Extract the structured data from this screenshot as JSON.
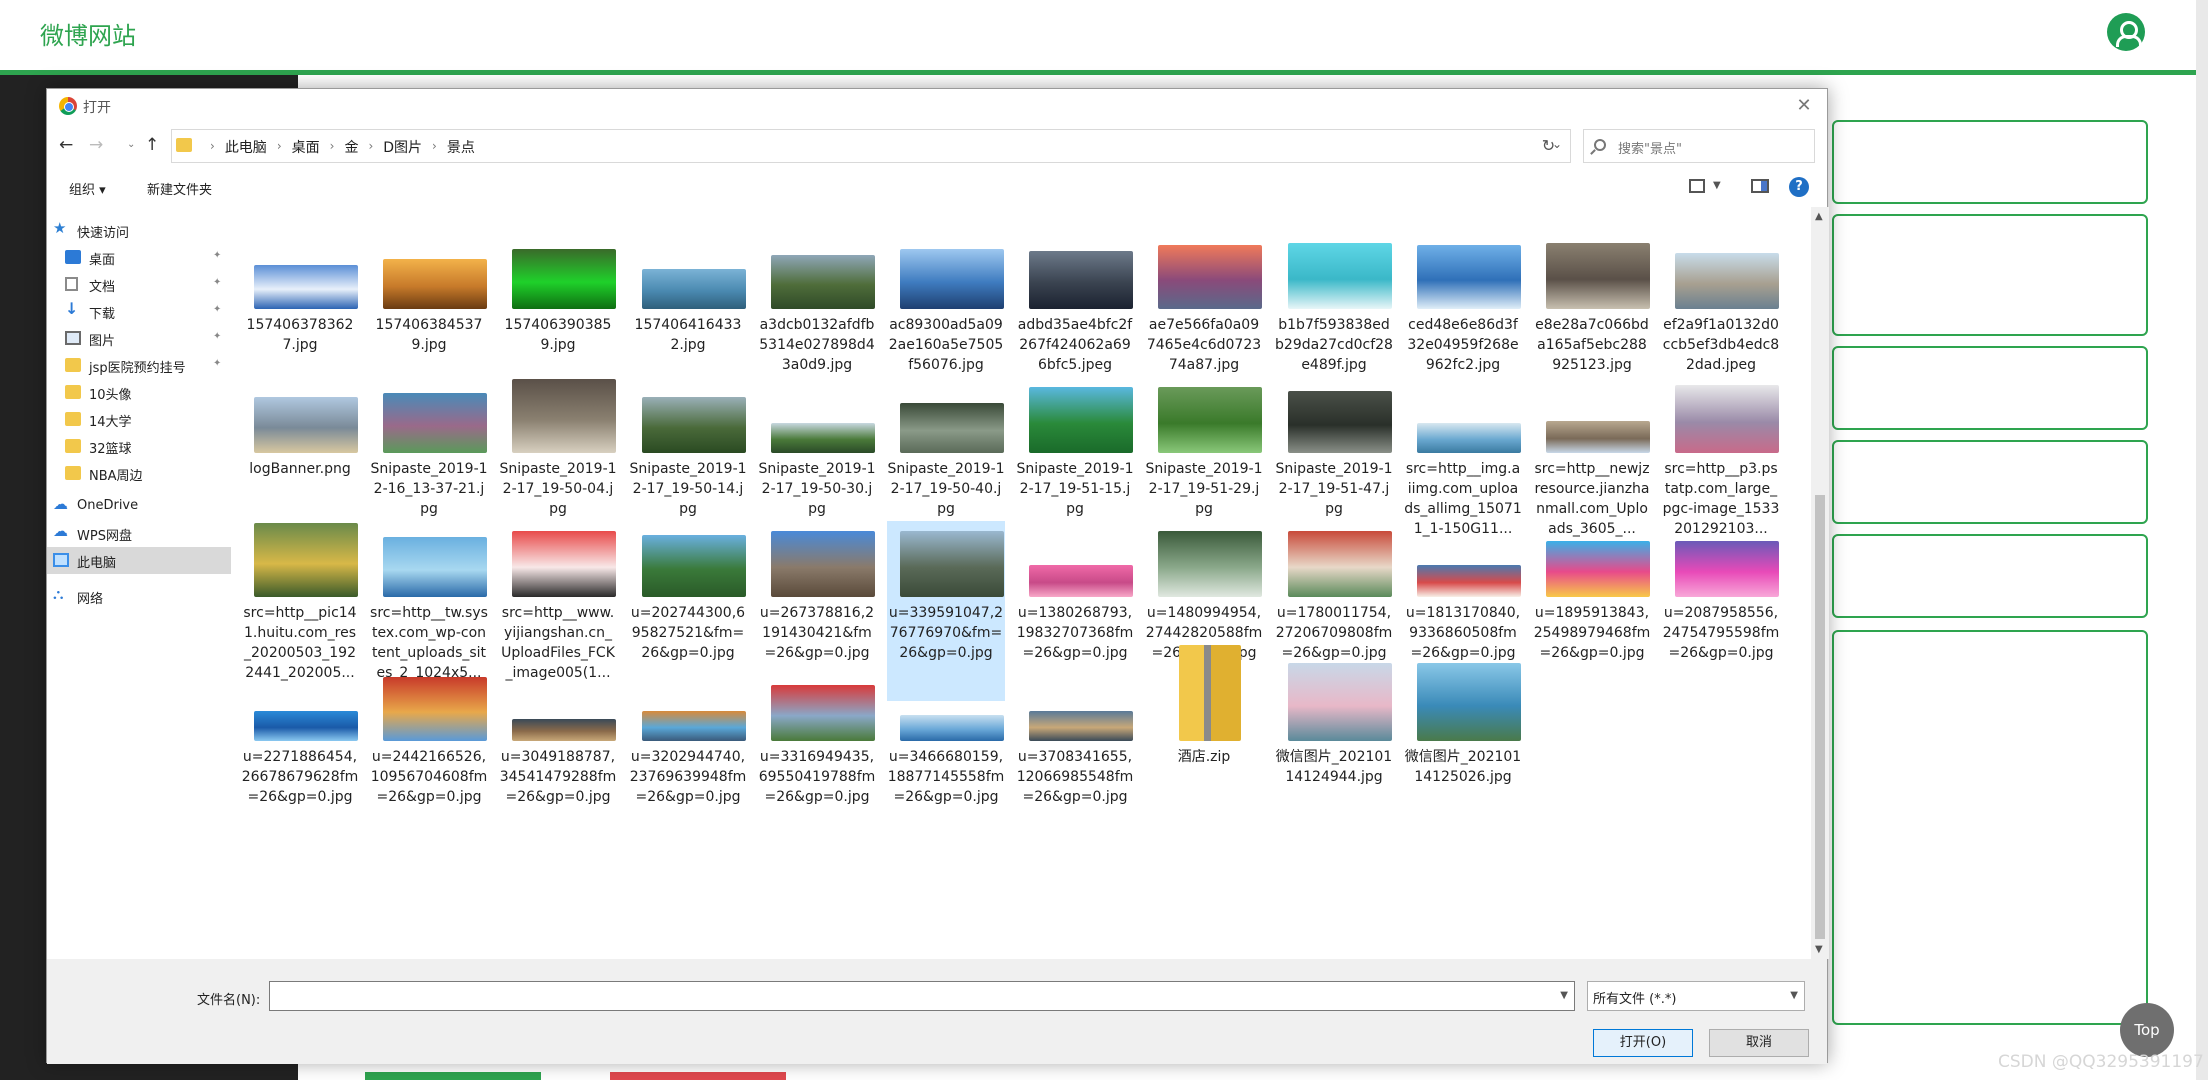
{
  "site": {
    "logo": "微博网站",
    "top_label": "Top",
    "watermark": "CSDN @QQ3295391197"
  },
  "dialog": {
    "title": "打开",
    "breadcrumbs": [
      "此电脑",
      "桌面",
      "金",
      "D图片",
      "景点"
    ],
    "search_placeholder": "搜索\"景点\"",
    "toolbar": {
      "organize": "组织 ▾",
      "new_folder": "新建文件夹"
    },
    "nav": [
      {
        "label": "快速访问",
        "icon": "star-icon",
        "pinned": false,
        "indent": 0
      },
      {
        "label": "桌面",
        "icon": "desktop-icon",
        "pinned": true,
        "indent": 1
      },
      {
        "label": "文档",
        "icon": "document-icon",
        "pinned": true,
        "indent": 1
      },
      {
        "label": "下载",
        "icon": "download-icon",
        "pinned": true,
        "indent": 1
      },
      {
        "label": "图片",
        "icon": "pictures-icon",
        "pinned": true,
        "indent": 1
      },
      {
        "label": "jsp医院预约挂号",
        "icon": "folder-icon",
        "pinned": true,
        "indent": 1
      },
      {
        "label": "10头像",
        "icon": "folder-icon",
        "pinned": false,
        "indent": 1
      },
      {
        "label": "14大学",
        "icon": "folder-icon",
        "pinned": false,
        "indent": 1
      },
      {
        "label": "32篮球",
        "icon": "folder-icon",
        "pinned": false,
        "indent": 1
      },
      {
        "label": "NBA周边",
        "icon": "folder-icon",
        "pinned": false,
        "indent": 1
      },
      {
        "label": "OneDrive",
        "icon": "onedrive-icon",
        "pinned": false,
        "indent": 0
      },
      {
        "label": "WPS网盘",
        "icon": "wps-cloud-icon",
        "pinned": false,
        "indent": 0
      },
      {
        "label": "此电脑",
        "icon": "this-pc-icon",
        "pinned": false,
        "indent": 0,
        "selected": true
      },
      {
        "label": "网络",
        "icon": "network-icon",
        "pinned": false,
        "indent": 0
      }
    ],
    "files": [
      {
        "name": "1574063783627.jpg",
        "colors": [
          "#5b8fd6",
          "#e8f0fa",
          "#2c63b3"
        ]
      },
      {
        "name": "1574063845379.jpg",
        "colors": [
          "#f3b24a",
          "#c77a2a",
          "#6a3b12"
        ]
      },
      {
        "name": "1574063903859.jpg",
        "colors": [
          "#3a6a2a",
          "#1fd12a",
          "#0f6e12"
        ]
      },
      {
        "name": "1574064164332.jpg",
        "colors": [
          "#7bb3d6",
          "#4a89b0",
          "#2f5f7a"
        ]
      },
      {
        "name": "a3dcb0132afdfb5314e027898d43a0d9.jpg",
        "colors": [
          "#8fa7b8",
          "#4f6d3a",
          "#2f4a28"
        ]
      },
      {
        "name": "ac89300ad5a092ae160a5e7505f56076.jpg",
        "colors": [
          "#9ec8f0",
          "#3f7cc0",
          "#1e3f70"
        ]
      },
      {
        "name": "adbd35ae4bfc2f267f424062a696bfc5.jpeg",
        "colors": [
          "#6d7a8a",
          "#3a4350",
          "#1b2230"
        ]
      },
      {
        "name": "ae7e566fa0a097465e4c6d072374a87.jpg",
        "colors": [
          "#f07a5a",
          "#8a4a7a",
          "#5a6a8a"
        ]
      },
      {
        "name": "b1b7f593838edb29da27cd0cf28e489f.jpg",
        "colors": [
          "#5fd6e6",
          "#3ab8c8",
          "#e8f6f8"
        ]
      },
      {
        "name": "ced48e6e86d3f32e04959f268e962fc2.jpg",
        "colors": [
          "#6fb0e8",
          "#2f70b8",
          "#e0eef8"
        ]
      },
      {
        "name": "e8e28a7c066bda165af5ebc288925123.jpg",
        "colors": [
          "#8a8070",
          "#5a5048",
          "#c8c0b0"
        ]
      },
      {
        "name": "ef2a9f1a0132d0ccb5ef3db4edc82dad.jpeg",
        "colors": [
          "#c8dcea",
          "#a8a090",
          "#6a8090"
        ]
      },
      {
        "name": "logBanner.png",
        "colors": [
          "#b0c8e0",
          "#7a8a98",
          "#d8c8a0"
        ]
      },
      {
        "name": "Snipaste_2019-12-16_13-37-21.jpg",
        "colors": [
          "#4a8ab8",
          "#9a6a8a",
          "#5a9a5a"
        ]
      },
      {
        "name": "Snipaste_2019-12-17_19-50-04.jpg",
        "colors": [
          "#5a5048",
          "#8a8070",
          "#d8d0c0"
        ]
      },
      {
        "name": "Snipaste_2019-12-17_19-50-14.jpg",
        "colors": [
          "#9ab0b8",
          "#4a6a3a",
          "#2a4a22"
        ]
      },
      {
        "name": "Snipaste_2019-12-17_19-50-30.jpg",
        "colors": [
          "#c8d8e0",
          "#4a7a3a",
          "#2a4a28"
        ]
      },
      {
        "name": "Snipaste_2019-12-17_19-50-40.jpg",
        "colors": [
          "#3a4a38",
          "#8a9a88",
          "#5a6a58"
        ]
      },
      {
        "name": "Snipaste_2019-12-17_19-51-15.jpg",
        "colors": [
          "#5ab8e0",
          "#2a8a3a",
          "#1a6a2a"
        ]
      },
      {
        "name": "Snipaste_2019-12-17_19-51-29.jpg",
        "colors": [
          "#6a9a5a",
          "#3a7a2a",
          "#8ac87a"
        ]
      },
      {
        "name": "Snipaste_2019-12-17_19-51-47.jpg",
        "colors": [
          "#4a5048",
          "#2a302a",
          "#8a9088"
        ]
      },
      {
        "name": "src=http__img.aiimg.com_uploads_allimg_150711_1-150G11...",
        "colors": [
          "#d8e8f0",
          "#6aa8d0",
          "#3a7aa0"
        ]
      },
      {
        "name": "src=http__newjzresource.jianzhanmall.com_Uploads_3605_...",
        "colors": [
          "#b8a890",
          "#7a6a58",
          "#c8d8e8"
        ]
      },
      {
        "name": "src=http__p3.pstatp.com_large_pgc-image_1533201292103...",
        "colors": [
          "#e8e8ea",
          "#9a8aa8",
          "#c86a8a"
        ]
      },
      {
        "name": "src=http__pic141.huitu.com_res_20200503_1922441_202005...",
        "colors": [
          "#6a8a4a",
          "#d8b848",
          "#3a5a2a"
        ]
      },
      {
        "name": "src=http__tw.systex.com_wp-content_uploads_sites_2_1024x5...",
        "colors": [
          "#6ab0e0",
          "#a8d8f0",
          "#2a6aa8"
        ]
      },
      {
        "name": "src=http__www.yijiangshan.cn_UploadFiles_FCK_image005(1...",
        "colors": [
          "#e84a4a",
          "#f8e8e8",
          "#2a2a2a"
        ]
      },
      {
        "name": "u=202744300,695827521&fm=26&gp=0.jpg",
        "colors": [
          "#6ab0e0",
          "#3a7a3a",
          "#2a5a28"
        ]
      },
      {
        "name": "u=267378816,2191430421&fm=26&gp=0.jpg",
        "colors": [
          "#4a8ad8",
          "#8a7a6a",
          "#5a4a3a"
        ]
      },
      {
        "name": "u=339591047,276776970&fm=26&gp=0.jpg",
        "colors": [
          "#9ab8d0",
          "#5a6a58",
          "#3a4a38"
        ],
        "selected": true
      },
      {
        "name": "u=1380268793,19832707368fm=26&gp=0.jpg",
        "colors": [
          "#f06aa8",
          "#c84a88",
          "#f8a8c8"
        ]
      },
      {
        "name": "u=1480994954,27442820588fm=26&gp=0.jpg",
        "colors": [
          "#3a5a3a",
          "#8aa88a",
          "#e0e8e0"
        ]
      },
      {
        "name": "u=1780011754,27206709808fm=26&gp=0.jpg",
        "colors": [
          "#c84a3a",
          "#e8d8c8",
          "#5a8a5a"
        ]
      },
      {
        "name": "u=1813170840,9336860508fm=26&gp=0.jpg",
        "colors": [
          "#4a7ab0",
          "#d84a4a",
          "#f8f0e8"
        ]
      },
      {
        "name": "u=1895913843,25498979468fm=26&gp=0.jpg",
        "colors": [
          "#3ab0e8",
          "#e84a8a",
          "#f8c848"
        ]
      },
      {
        "name": "u=2087958556,24754795598fm=26&gp=0.jpg",
        "colors": [
          "#6a5ab8",
          "#e84ab8",
          "#f8a8d8"
        ]
      },
      {
        "name": "u=2271886454,26678679628fm=26&gp=0.jpg",
        "colors": [
          "#2a8ad8",
          "#1a5aa8",
          "#8ac8f0"
        ]
      },
      {
        "name": "u=2442166526,10956704608fm=26&gp=0.jpg",
        "colors": [
          "#c83a2a",
          "#e8a84a",
          "#5a9ad8"
        ]
      },
      {
        "name": "u=3049188787,34541479288fm=26&gp=0.jpg",
        "colors": [
          "#3a4a58",
          "#8a6a4a",
          "#c8a878"
        ]
      },
      {
        "name": "u=3202944740,23769639948fm=26&gp=0.jpg",
        "colors": [
          "#d88a3a",
          "#5aa8d8",
          "#3a5a7a"
        ]
      },
      {
        "name": "u=3316949435,69550419788fm=26&gp=0.jpg",
        "colors": [
          "#d83a3a",
          "#8aa8c8",
          "#4a7a3a"
        ]
      },
      {
        "name": "u=3466680159,18877145558fm=26&gp=0.jpg",
        "colors": [
          "#c8e0f0",
          "#6aa8d8",
          "#2a6aa8"
        ]
      },
      {
        "name": "u=3708341655,12066985548fm=26&gp=0.jpg",
        "colors": [
          "#5a7a98",
          "#c8a878",
          "#3a4a58"
        ]
      },
      {
        "name": "酒店.zip",
        "colors": [
          "#f2c84b",
          "#e0b030",
          "#8a8a8a"
        ],
        "zip": true
      },
      {
        "name": "微信图片_20210114124944.jpg",
        "colors": [
          "#c8d8e8",
          "#e8b8c8",
          "#5a8a9a"
        ]
      },
      {
        "name": "微信图片_20210114125026.jpg",
        "colors": [
          "#8ac8e8",
          "#3a8ab8",
          "#4a7a4a"
        ]
      }
    ],
    "file_name_label": "文件名(N):",
    "file_name_value": "",
    "file_type": "所有文件 (*.*)",
    "open_label": "打开(O)",
    "cancel_label": "取消"
  }
}
